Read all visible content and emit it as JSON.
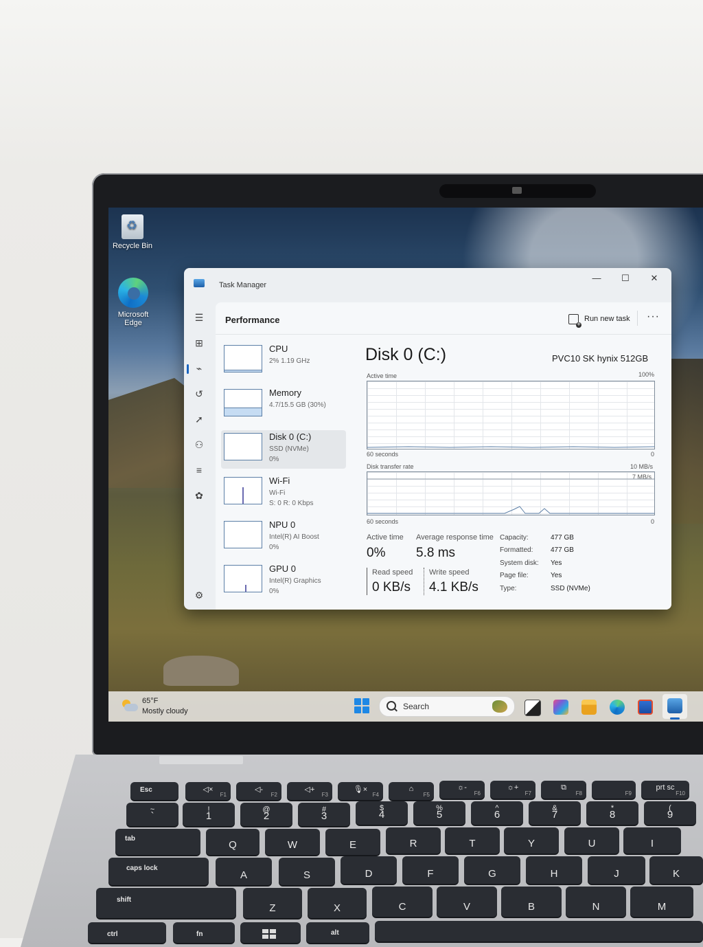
{
  "desktop": {
    "icons": [
      {
        "label": "Recycle Bin"
      },
      {
        "label_line1": "Microsoft",
        "label_line2": "Edge"
      }
    ]
  },
  "window": {
    "title": "Task Manager",
    "page_title": "Performance",
    "run_new_task": "Run new task",
    "more": "···"
  },
  "perf_list": [
    {
      "name": "CPU",
      "line1": "2%  1.19 GHz",
      "line2": ""
    },
    {
      "name": "Memory",
      "line1": "4.7/15.5 GB (30%)",
      "line2": ""
    },
    {
      "name": "Disk 0 (C:)",
      "line1": "SSD (NVMe)",
      "line2": "0%"
    },
    {
      "name": "Wi-Fi",
      "line1": "Wi-Fi",
      "line2": "S: 0  R: 0 Kbps"
    },
    {
      "name": "NPU 0",
      "line1": "Intel(R) AI Boost",
      "line2": "0%"
    },
    {
      "name": "GPU 0",
      "line1": "Intel(R) Graphics",
      "line2": "0%"
    }
  ],
  "detail": {
    "title": "Disk 0 (C:)",
    "model": "PVC10 SK hynix 512GB",
    "graph1": {
      "label": "Active time",
      "max": "100%",
      "time": "60 seconds",
      "min": "0"
    },
    "graph2": {
      "label": "Disk transfer rate",
      "max": "10 MB/s",
      "inner_max": "7 MB/s",
      "time": "60 seconds",
      "min": "0"
    },
    "stats": {
      "active_time_label": "Active time",
      "active_time_value": "0%",
      "avg_response_label": "Average response time",
      "avg_response_value": "5.8 ms",
      "read_speed_label": "Read speed",
      "read_speed_value": "0 KB/s",
      "write_speed_label": "Write speed",
      "write_speed_value": "4.1 KB/s"
    },
    "props": [
      {
        "key": "Capacity:",
        "value": "477 GB"
      },
      {
        "key": "Formatted:",
        "value": "477 GB"
      },
      {
        "key": "System disk:",
        "value": "Yes"
      },
      {
        "key": "Page file:",
        "value": "Yes"
      },
      {
        "key": "Type:",
        "value": "SSD (NVMe)"
      }
    ]
  },
  "taskbar": {
    "temperature": "65°F",
    "condition": "Mostly cloudy",
    "search_placeholder": "Search"
  },
  "keyboard": {
    "fn_row": [
      {
        "main": "Esc",
        "fn": ""
      },
      {
        "main": "◁×",
        "fn": "F1"
      },
      {
        "main": "◁-",
        "fn": "F2"
      },
      {
        "main": "◁+",
        "fn": "F3"
      },
      {
        "main": "🎙×",
        "fn": "F4"
      },
      {
        "main": "⌂",
        "fn": "F5"
      },
      {
        "main": "☼-",
        "fn": "F6"
      },
      {
        "main": "☼+",
        "fn": "F7"
      },
      {
        "main": "⧉",
        "fn": "F8"
      },
      {
        "main": "",
        "fn": "F9"
      },
      {
        "main": "prt sc",
        "fn": "F10"
      }
    ],
    "num_row": [
      {
        "top": "~",
        "main": "`"
      },
      {
        "top": "!",
        "main": "1"
      },
      {
        "top": "@",
        "main": "2"
      },
      {
        "top": "#",
        "main": "3"
      },
      {
        "top": "$",
        "main": "4"
      },
      {
        "top": "%",
        "main": "5"
      },
      {
        "top": "^",
        "main": "6"
      },
      {
        "top": "&",
        "main": "7"
      },
      {
        "top": "*",
        "main": "8"
      },
      {
        "top": "(",
        "main": "9"
      }
    ],
    "qwerty_row": [
      "tab",
      "Q",
      "W",
      "E",
      "R",
      "T",
      "Y",
      "U",
      "I"
    ],
    "asdf_row": [
      "caps lock",
      "A",
      "S",
      "D",
      "F",
      "G",
      "H",
      "J",
      "K"
    ],
    "zxcv_row": [
      "shift",
      "Z",
      "X",
      "C",
      "V",
      "B",
      "N",
      "M"
    ],
    "bottom_row": [
      "ctrl",
      "fn",
      "",
      "alt"
    ]
  },
  "colors": {
    "accent": "#1a65c0",
    "window_bg": "#eceff2",
    "graph_line": "#5b7ea6"
  }
}
